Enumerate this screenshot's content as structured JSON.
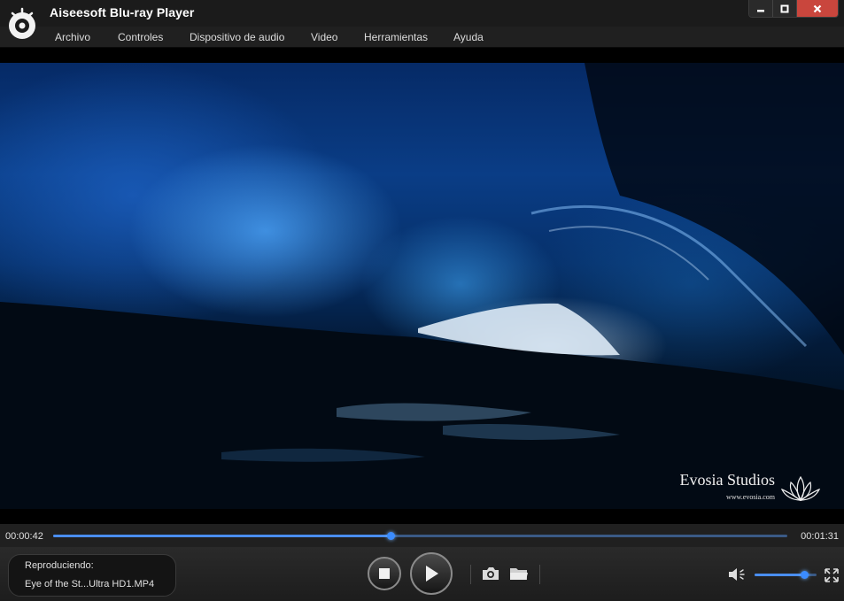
{
  "window": {
    "title": "Aiseesoft Blu-ray Player",
    "close_color": "#c9463d"
  },
  "menu": {
    "items": [
      {
        "label": "Archivo"
      },
      {
        "label": "Controles"
      },
      {
        "label": "Dispositivo de audio"
      },
      {
        "label": "Video"
      },
      {
        "label": "Herramientas"
      },
      {
        "label": "Ayuda"
      }
    ]
  },
  "video": {
    "watermark_title": "Evosia Studios",
    "watermark_url": "www.evosia.com"
  },
  "playback": {
    "current_time": "00:00:42",
    "total_time": "00:01:31",
    "progress": 0.46
  },
  "now_playing": {
    "label": "Reproduciendo:",
    "file": "Eye of the St...Ultra HD1.MP4"
  },
  "volume": {
    "level": 0.8
  },
  "colors": {
    "accent": "#3b8cff",
    "track": "#3a5a86"
  },
  "icons": [
    "app-logo-icon",
    "minimize-icon",
    "maximize-icon",
    "close-icon",
    "stop-icon",
    "play-icon",
    "camera-icon",
    "folder-icon",
    "volume-icon",
    "fullscreen-icon",
    "lotus-icon"
  ]
}
